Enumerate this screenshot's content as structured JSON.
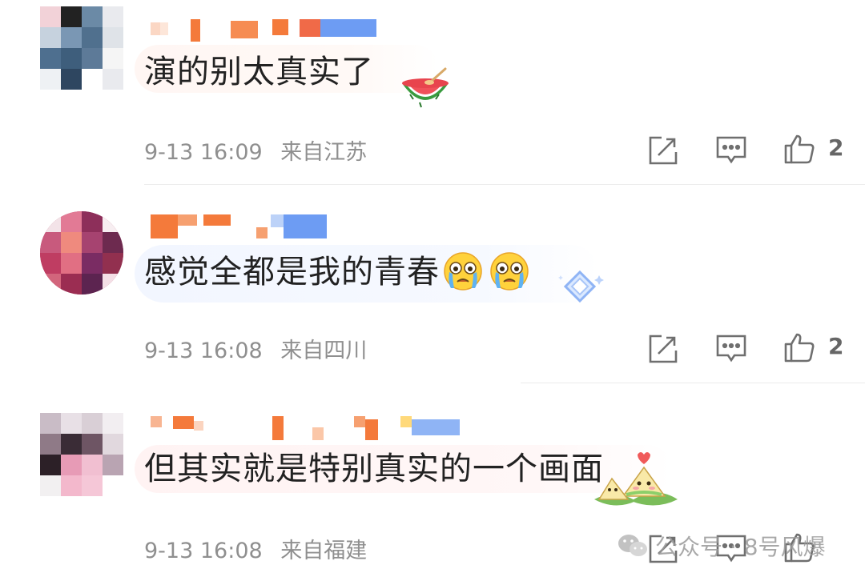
{
  "comments": [
    {
      "text": "演的别太真实了",
      "date": "9-13 16:09",
      "location": "来自江苏",
      "likes": "2",
      "sticker": "watermelon-icon"
    },
    {
      "text": "感觉全都是我的青春",
      "date": "9-13 16:08",
      "location": "来自四川",
      "likes": "2",
      "sticker": "crying-face-icon"
    },
    {
      "text": "但其实就是特别真实的一个画面",
      "date": "9-13 16:08",
      "location": "来自福建",
      "likes": "",
      "sticker": "zongzi-icon"
    }
  ],
  "watermark": {
    "text": "公众号 · 8号风爆",
    "icon": "wechat-icon"
  },
  "colors": {
    "text": "#222222",
    "meta": "#8f8f8f",
    "nick_orange": "#f47a3b",
    "nick_blue": "#6d9cf3"
  }
}
